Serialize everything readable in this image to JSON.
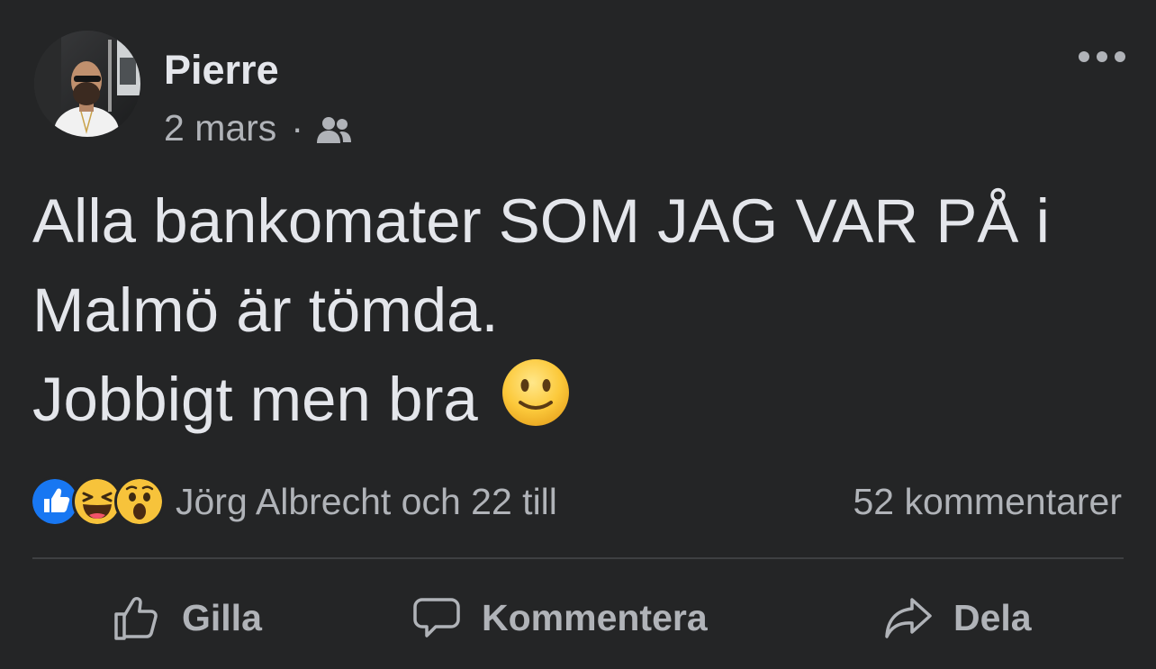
{
  "post": {
    "author": "Pierre",
    "date": "2 mars",
    "separator": "·",
    "audience_icon": "friends-icon",
    "more_icon": "more-options-icon",
    "body_lines": [
      "Alla bankomater SOM JAG VAR PÅ i",
      "Malmö är tömda.",
      "Jobbigt men bra"
    ],
    "body_emoji": "slightly-smiling-face-emoji"
  },
  "reactions": {
    "icons": [
      "like-reaction-icon",
      "haha-reaction-icon",
      "wow-reaction-icon"
    ],
    "summary": "Jörg Albrecht och 22 till",
    "comments": "52 kommentarer"
  },
  "actions": {
    "like": "Gilla",
    "comment": "Kommentera",
    "share": "Dela"
  },
  "colors": {
    "background": "#242526",
    "primary_text": "#e4e6eb",
    "secondary_text": "#b0b3b8",
    "like_blue": "#1877f2",
    "divider": "#3e4042"
  }
}
